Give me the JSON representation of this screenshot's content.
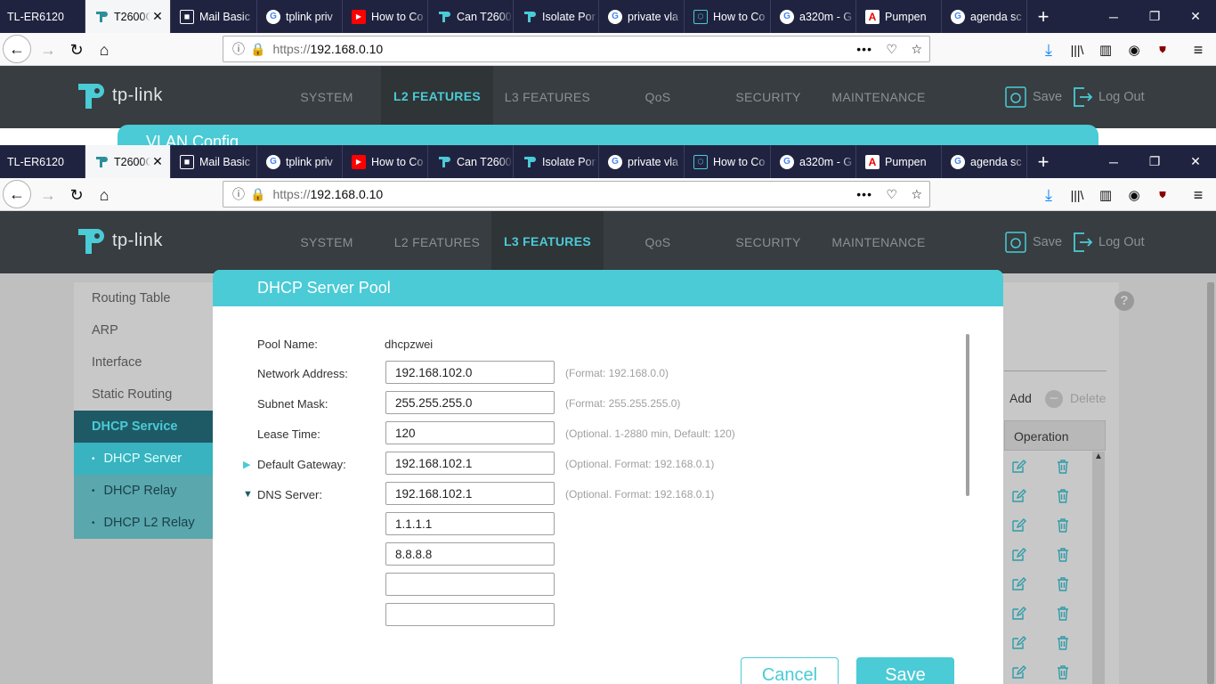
{
  "browser_top": {
    "tabs": [
      {
        "label": "TL-ER6120",
        "icon": "none",
        "active": false
      },
      {
        "label": "T2600G",
        "icon": "tplink-icon",
        "active": true
      },
      {
        "label": "Mail Basic",
        "icon": "mail-icon",
        "active": false
      },
      {
        "label": "tplink priv",
        "icon": "google-icon",
        "active": false
      },
      {
        "label": "How to Co",
        "icon": "youtube-icon",
        "active": false
      },
      {
        "label": "Can T2600",
        "icon": "tplink-icon",
        "active": false
      },
      {
        "label": "Isolate Por",
        "icon": "tplink-icon",
        "active": false
      },
      {
        "label": "private vla",
        "icon": "google-icon",
        "active": false
      },
      {
        "label": "How to Co",
        "icon": "shield-icon",
        "active": false
      },
      {
        "label": "a320m - G",
        "icon": "google-icon",
        "active": false
      },
      {
        "label": "Pumpen",
        "icon": "adobe-icon",
        "active": false
      },
      {
        "label": "agenda sc",
        "icon": "google-icon",
        "active": false
      }
    ],
    "url_protocol": "https://",
    "url_host": "192.168.0.10",
    "nav_menu": [
      "SYSTEM",
      "L2 FEATURES",
      "L3 FEATURES",
      "QoS",
      "SECURITY",
      "MAINTENANCE"
    ],
    "active_menu": "L2 FEATURES",
    "save_label": "Save",
    "logout_label": "Log Out",
    "brand": "tp-link",
    "partial_panel_title": "VLAN Config"
  },
  "browser": {
    "tabs": [
      {
        "label": "TL-ER6120",
        "icon": "none",
        "active": false
      },
      {
        "label": "T2600G",
        "icon": "tplink-icon",
        "active": true
      },
      {
        "label": "Mail Basic",
        "icon": "mail-icon",
        "active": false
      },
      {
        "label": "tplink priv",
        "icon": "google-icon",
        "active": false
      },
      {
        "label": "How to Co",
        "icon": "youtube-icon",
        "active": false
      },
      {
        "label": "Can T2600",
        "icon": "tplink-icon",
        "active": false
      },
      {
        "label": "Isolate Por",
        "icon": "tplink-icon",
        "active": false
      },
      {
        "label": "private vla",
        "icon": "google-icon",
        "active": false
      },
      {
        "label": "How to Co",
        "icon": "shield-icon",
        "active": false
      },
      {
        "label": "a320m - G",
        "icon": "google-icon",
        "active": false
      },
      {
        "label": "Pumpen",
        "icon": "adobe-icon",
        "active": false
      },
      {
        "label": "agenda sc",
        "icon": "google-icon",
        "active": false
      }
    ],
    "url_protocol": "https://",
    "url_host": "192.168.0.10"
  },
  "header": {
    "brand": "tp-link",
    "nav_menu": [
      "SYSTEM",
      "L2 FEATURES",
      "L3 FEATURES",
      "QoS",
      "SECURITY",
      "MAINTENANCE"
    ],
    "active_menu": "L3 FEATURES",
    "save_label": "Save",
    "logout_label": "Log Out"
  },
  "sidebar": {
    "items": [
      "Routing Table",
      "ARP",
      "Interface",
      "Static Routing"
    ],
    "group": "DHCP Service",
    "sub_items": [
      "DHCP Server",
      "DHCP Relay",
      "DHCP L2 Relay"
    ],
    "current": "DHCP Server"
  },
  "background_panel": {
    "add_label": "Add",
    "delete_label": "Delete",
    "operation_header": "Operation",
    "help_icon": "?"
  },
  "modal": {
    "title": "DHCP Server Pool",
    "pool_name_label": "Pool Name:",
    "pool_name_value": "dhcpzwei",
    "network_address_label": "Network Address:",
    "network_address_value": "192.168.102.0",
    "network_address_hint": "(Format: 192.168.0.0)",
    "subnet_mask_label": "Subnet Mask:",
    "subnet_mask_value": "255.255.255.0",
    "subnet_mask_hint": "(Format: 255.255.255.0)",
    "lease_time_label": "Lease Time:",
    "lease_time_value": "120",
    "lease_time_hint": "(Optional. 1-2880 min, Default: 120)",
    "default_gateway_label": "Default Gateway:",
    "default_gateway_value": "192.168.102.1",
    "default_gateway_hint": "(Optional. Format: 192.168.0.1)",
    "dns_server_label": "DNS Server:",
    "dns_values": [
      "192.168.102.1",
      "1.1.1.1",
      "8.8.8.8",
      "",
      ""
    ],
    "dns_hint": "(Optional. Format: 192.168.0.1)",
    "cancel_label": "Cancel",
    "save_label": "Save"
  },
  "colors": {
    "accent": "#4acbd6",
    "header_bg": "#373d40",
    "tabstrip_bg": "#202340"
  }
}
